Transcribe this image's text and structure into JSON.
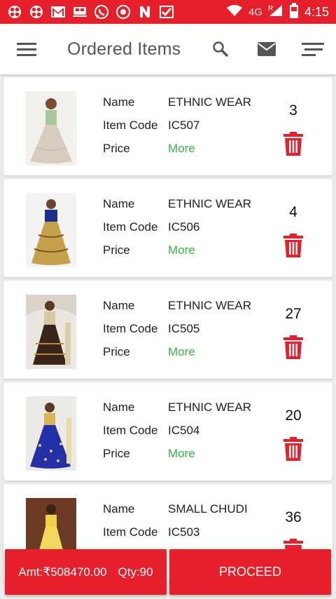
{
  "status_bar": {
    "network": "4G",
    "roaming": "R",
    "time": "4:15",
    "icons": [
      "app-icon",
      "app-icon",
      "gmail-icon",
      "app-icon",
      "whatsapp-icon",
      "app-icon",
      "n-icon",
      "app-icon"
    ]
  },
  "app_bar": {
    "title": "Ordered Items"
  },
  "labels": {
    "name": "Name",
    "item_code": "Item Code",
    "price": "Price",
    "more": "More"
  },
  "items": [
    {
      "name": "ETHNIC WEAR",
      "code": "IC507",
      "qty": "3"
    },
    {
      "name": "ETHNIC WEAR",
      "code": "IC506",
      "qty": "4"
    },
    {
      "name": "ETHNIC WEAR",
      "code": "IC505",
      "qty": "27"
    },
    {
      "name": "ETHNIC WEAR",
      "code": "IC504",
      "qty": "20"
    },
    {
      "name": "SMALL CHUDI",
      "code": "IC503",
      "qty": "36"
    }
  ],
  "footer": {
    "amount": "Amt:₹508470.00",
    "quantity": "Qty:90",
    "proceed_label": "PROCEED"
  },
  "colors": {
    "brand_red": "#e5202b",
    "more_green": "#37b34a"
  }
}
